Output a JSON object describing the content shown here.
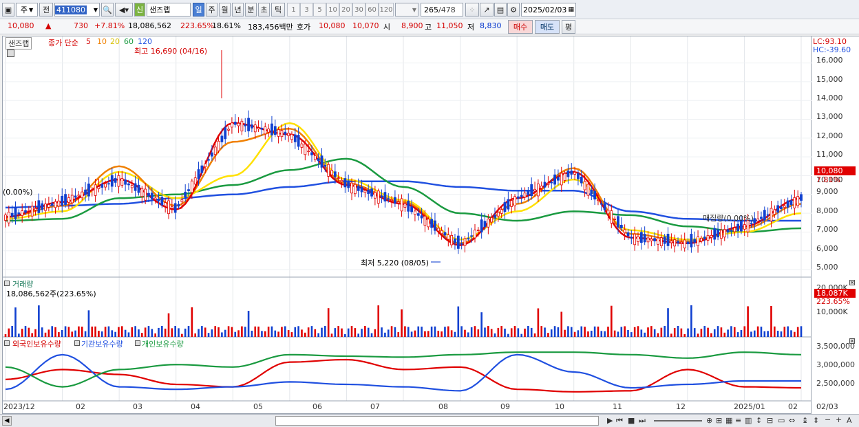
{
  "toolbar": {
    "market_type": "주",
    "scope": "전",
    "code": "411080",
    "stock_name": "샌즈랩",
    "new_badge": "신",
    "periods": [
      "일",
      "주",
      "월",
      "년",
      "분",
      "초",
      "틱"
    ],
    "selected_period": "일",
    "minute_presets": [
      "1",
      "3",
      "5",
      "10",
      "20",
      "30",
      "60",
      "120"
    ],
    "bar_count": "265",
    "bar_total": "/478",
    "date": "2025/02/03"
  },
  "quote": {
    "price": "10,080",
    "change_arrow": "▲",
    "change": "730",
    "change_pct": "+7.81%",
    "volume": "18,086,562",
    "volume_ratio": "223.65%",
    "turnover": "18.61%",
    "amount": "183,456백만",
    "hoga_label": "호가",
    "ask": "10,080",
    "bid": "10,070",
    "open_label": "시",
    "open": "8,900",
    "high_label": "고",
    "high": "11,050",
    "low_label": "저",
    "low": "8,830",
    "buy_label": "매수",
    "sell_label": "매도",
    "even_label": "평"
  },
  "price_pane": {
    "title": "샌즈랩",
    "ma_label": "종가 단순",
    "ma_periods": [
      "5",
      "10",
      "20",
      "60",
      "120"
    ],
    "ma_colors": [
      "#e00000",
      "#f08000",
      "#ffe000",
      "#1a9a40",
      "#2050e0"
    ],
    "max_annotation": "최고 16,690 (04/16)",
    "min_annotation": "최저 5,220 (08/05)",
    "zero_label": "(0.00%)",
    "avg_label": "매집량(0.00%)",
    "lc": "LC:93.10",
    "hc": "HC:-39.60",
    "y_ticks": [
      "16,000",
      "15,000",
      "14,000",
      "13,000",
      "12,000",
      "11,000",
      "10,000",
      "9,000",
      "8,000",
      "7,000",
      "6,000",
      "5,000"
    ],
    "current_tag": "10,080",
    "pct_tag": "7.81%"
  },
  "volume_pane": {
    "title": "거래량",
    "value": "18,086,562주(223.65%)",
    "y_ticks": [
      "20,000K",
      "10,000K"
    ],
    "current_tag": "18,087K",
    "pct_tag": "223.65%"
  },
  "holding_pane": {
    "legend": [
      "외국인보유수량",
      "기관보유수량",
      "개인보유수량"
    ],
    "colors": [
      "#e00000",
      "#2050e0",
      "#1a9a40"
    ],
    "y_ticks": [
      "3,500,000",
      "3,000,000",
      "2,500,000"
    ]
  },
  "x_axis": [
    "2023/12",
    "02",
    "03",
    "04",
    "05",
    "06",
    "07",
    "08",
    "09",
    "10",
    "11",
    "12",
    "2025/01",
    "02",
    "02/03"
  ],
  "chart_data": {
    "type": "line",
    "title": "샌즈랩",
    "ylim": [
      4600,
      16900
    ],
    "x": [
      "2023/12",
      "2024/01",
      "2024/02",
      "2024/03",
      "2024/04",
      "2024/05",
      "2024/06",
      "2024/07",
      "2024/08",
      "2024/09",
      "2024/10",
      "2024/11",
      "2024/12",
      "2025/01",
      "2025/02"
    ],
    "series": [
      {
        "name": "5",
        "values": [
          7800,
          8600,
          9800,
          8200,
          12800,
          12200,
          9500,
          8500,
          6300,
          8800,
          10200,
          6700,
          6400,
          7300,
          8800
        ]
      },
      {
        "name": "10",
        "values": [
          7800,
          8400,
          10500,
          8400,
          11800,
          12500,
          9600,
          8600,
          6400,
          8500,
          10400,
          6900,
          6500,
          7200,
          8500
        ]
      },
      {
        "name": "20",
        "values": [
          7700,
          8100,
          10200,
          8800,
          10000,
          12800,
          9800,
          8700,
          6600,
          8100,
          9800,
          7100,
          6600,
          7000,
          8000
        ]
      },
      {
        "name": "60",
        "values": [
          7600,
          7700,
          8800,
          9000,
          9500,
          10300,
          10900,
          9400,
          8000,
          7600,
          8100,
          7900,
          7300,
          7000,
          7200
        ]
      },
      {
        "name": "120",
        "values": [
          8300,
          8400,
          8500,
          8800,
          9000,
          9400,
          9700,
          9700,
          9400,
          9200,
          9200,
          8100,
          7700,
          7600,
          7600
        ]
      }
    ]
  }
}
